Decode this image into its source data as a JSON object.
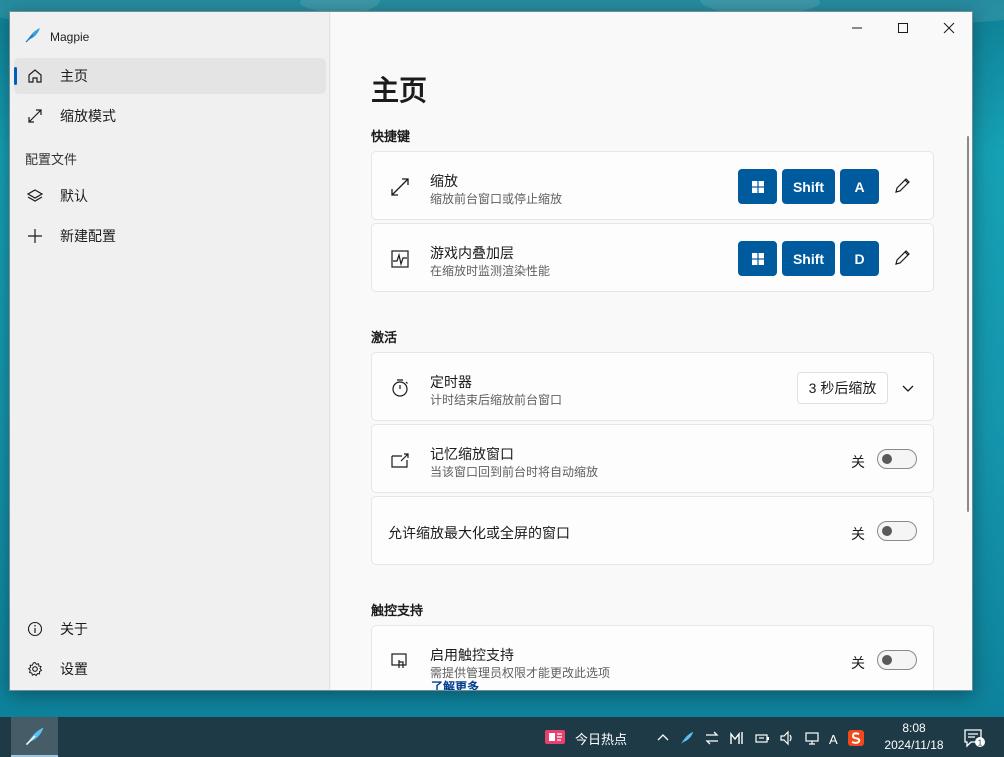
{
  "app": {
    "title": "Magpie"
  },
  "sidebar": {
    "items": [
      {
        "label": "主页",
        "icon": "home-icon",
        "selected": true
      },
      {
        "label": "缩放模式",
        "icon": "resize-diagonal-icon"
      }
    ],
    "profiles_header": "配置文件",
    "profiles": [
      {
        "label": "默认",
        "icon": "layers-icon"
      },
      {
        "label": "新建配置",
        "icon": "plus-icon"
      }
    ],
    "footer": [
      {
        "label": "关于",
        "icon": "info-icon"
      },
      {
        "label": "设置",
        "icon": "gear-icon"
      }
    ]
  },
  "main": {
    "page_title": "主页",
    "hotkeys": {
      "header": "快捷键",
      "items": [
        {
          "title": "缩放",
          "subtitle": "缩放前台窗口或停止缩放",
          "icon": "resize-diagonal-icon",
          "keys": [
            "⊞",
            "Shift",
            "A"
          ]
        },
        {
          "title": "游戏内叠加层",
          "subtitle": "在缩放时监测渲染性能",
          "icon": "performance-chart-icon",
          "keys": [
            "⊞",
            "Shift",
            "D"
          ]
        }
      ]
    },
    "activation": {
      "header": "激活",
      "timer": {
        "title": "定时器",
        "subtitle": "计时结束后缩放前台窗口",
        "dropdown_value": "3 秒后缩放"
      },
      "remember": {
        "title": "记忆缩放窗口",
        "subtitle": "当该窗口回到前台时将自动缩放",
        "toggle_label": "关",
        "on": false
      },
      "allow_maximized": {
        "title": "允许缩放最大化或全屏的窗口",
        "toggle_label": "关",
        "on": false
      }
    },
    "touch": {
      "header": "触控支持",
      "enable": {
        "title": "启用触控支持",
        "subtitle": "需提供管理员权限才能更改此选项",
        "link": "了解更多",
        "toggle_label": "关",
        "on": false
      }
    }
  },
  "taskbar": {
    "news_label": "今日热点",
    "tray_input_indicator": "A",
    "time": "8:08",
    "date": "2024/11/18",
    "notification_count": "1"
  },
  "colors": {
    "accent": "#005a9e",
    "selection_indicator": "#005fb8",
    "link": "#003e92"
  }
}
